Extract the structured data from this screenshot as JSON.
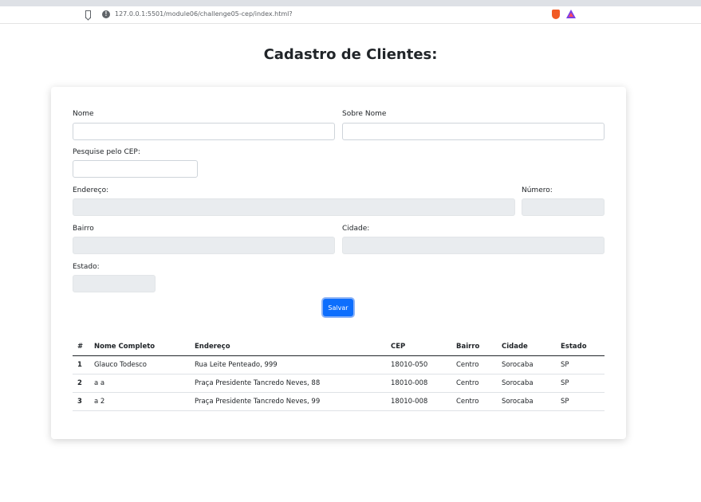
{
  "browser": {
    "url": "127.0.0.1:5501/module06/challenge05-cep/index.html?"
  },
  "page": {
    "title": "Cadastro de Clientes:"
  },
  "form": {
    "nome_label": "Nome",
    "nome_value": "",
    "sobrenome_label": "Sobre Nome",
    "sobrenome_value": "",
    "cep_label": "Pesquise pelo CEP:",
    "cep_value": "",
    "endereco_label": "Endereço:",
    "numero_label": "Número:",
    "bairro_label": "Bairro",
    "cidade_label": "Cidade:",
    "estado_label": "Estado:",
    "save_label": "Salvar"
  },
  "table": {
    "headers": [
      "#",
      "Nome Completo",
      "Endereço",
      "CEP",
      "Bairro",
      "Cidade",
      "Estado"
    ],
    "rows": [
      [
        "1",
        "Glauco Todesco",
        "Rua Leite Penteado, 999",
        "18010-050",
        "Centro",
        "Sorocaba",
        "SP"
      ],
      [
        "2",
        "a a",
        "Praça Presidente Tancredo Neves, 88",
        "18010-008",
        "Centro",
        "Sorocaba",
        "SP"
      ],
      [
        "3",
        "a 2",
        "Praça Presidente Tancredo Neves, 99",
        "18010-008",
        "Centro",
        "Sorocaba",
        "SP"
      ]
    ]
  }
}
